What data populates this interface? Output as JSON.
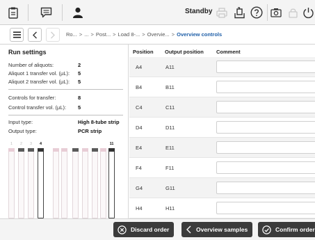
{
  "toolbar": {
    "standby_label": "Standby"
  },
  "breadcrumb": {
    "items": [
      "Ro...",
      "...",
      "Post...",
      "Load 8-...",
      "Overvie..."
    ],
    "current": "Overview controls",
    "separator": ">"
  },
  "run_settings": {
    "title": "Run settings",
    "fields": [
      {
        "label": "Number of aliquots:",
        "value": "2"
      },
      {
        "label": "Aliquot 1 transfer vol. (µL):",
        "value": "5"
      },
      {
        "label": "Aliquot 2 transfer vol. (µL):",
        "value": "5"
      },
      {
        "label": "Controls for transfer:",
        "value": "8"
      },
      {
        "label": "Control transfer vol. (µL):",
        "value": "5"
      },
      {
        "label": "Input type:",
        "value": "High 8-tube strip"
      },
      {
        "label": "Output type:",
        "value": "PCR strip"
      }
    ],
    "tube_numbers": [
      "1",
      "2",
      "3",
      "4",
      "",
      "",
      "",
      "",
      "",
      "",
      "11"
    ]
  },
  "table": {
    "headers": {
      "position": "Position",
      "output": "Output position",
      "comment": "Comment"
    },
    "rows": [
      {
        "position": "A4",
        "output": "A11",
        "comment": ""
      },
      {
        "position": "B4",
        "output": "B11",
        "comment": ""
      },
      {
        "position": "C4",
        "output": "C11",
        "comment": ""
      },
      {
        "position": "D4",
        "output": "D11",
        "comment": ""
      },
      {
        "position": "E4",
        "output": "E11",
        "comment": ""
      },
      {
        "position": "F4",
        "output": "F11",
        "comment": ""
      },
      {
        "position": "G4",
        "output": "G11",
        "comment": ""
      },
      {
        "position": "H4",
        "output": "H11",
        "comment": ""
      }
    ]
  },
  "actions": {
    "discard": "Discard order",
    "overview_samples": "Overview samples",
    "confirm": "Confirm order"
  }
}
